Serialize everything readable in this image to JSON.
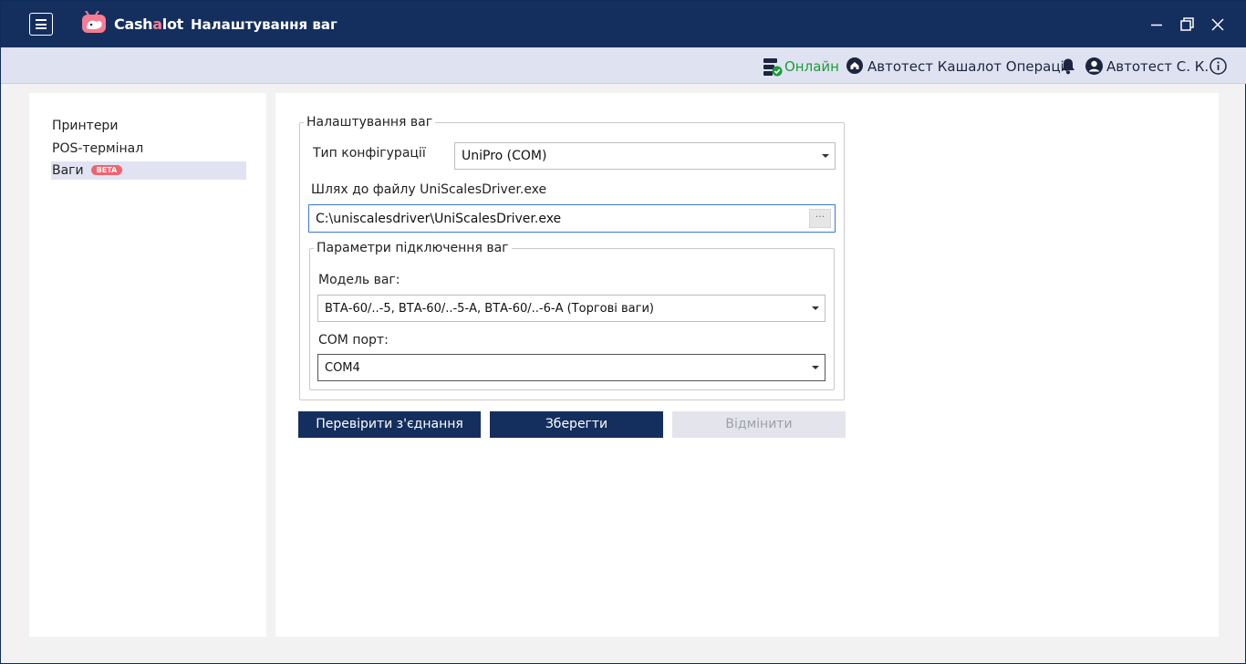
{
  "titlebar": {
    "brand_prefix": "Cash",
    "brand_accent": "a",
    "brand_suffix": "lot",
    "title": "Налаштування ваг",
    "icons": [
      "menu-icon",
      "logo-icon",
      "minimize-icon",
      "restore-icon",
      "close-icon"
    ]
  },
  "status": {
    "online": "Онлайн",
    "organization": "Автотест Кашалот Операції",
    "user": "Автотест С. К.",
    "icons": [
      "server-check-icon",
      "home-icon",
      "bell-icon",
      "user-icon",
      "info-icon"
    ]
  },
  "sidebar": {
    "items": [
      {
        "label": "Принтери"
      },
      {
        "label": "POS-термінал"
      },
      {
        "label": "Ваги",
        "badge": "BETA",
        "active": true
      }
    ]
  },
  "form": {
    "legend": "Налаштування ваг",
    "config_type_label": "Тип конфігурації",
    "config_type_value": "UniPro (COM)",
    "path_label": "Шлях до файлу UniScalesDriver.exe",
    "path_value": "C:\\uniscalesdriver\\UniScalesDriver.exe",
    "browse_label": "···",
    "connection": {
      "legend": "Параметри підключення ваг",
      "model_label": "Модель ваг:",
      "model_value": "ВТА-60/..-5, ВТА-60/..-5-А, ВТА-60/..-6-А (Торгові ваги)",
      "port_label": "COM порт:",
      "port_value": "COM4"
    }
  },
  "buttons": {
    "check": "Перевірити з'єднання",
    "save": "Зберегти",
    "cancel": "Відмінити"
  },
  "colors": {
    "titlebar": "#142f5e",
    "statusbar": "#dfe3f1",
    "online": "#1f9a3b",
    "accent": "#f47c93",
    "primary_button": "#142f5e",
    "disabled_button": "#e4e5ec",
    "beta_badge": "#f2636f"
  }
}
